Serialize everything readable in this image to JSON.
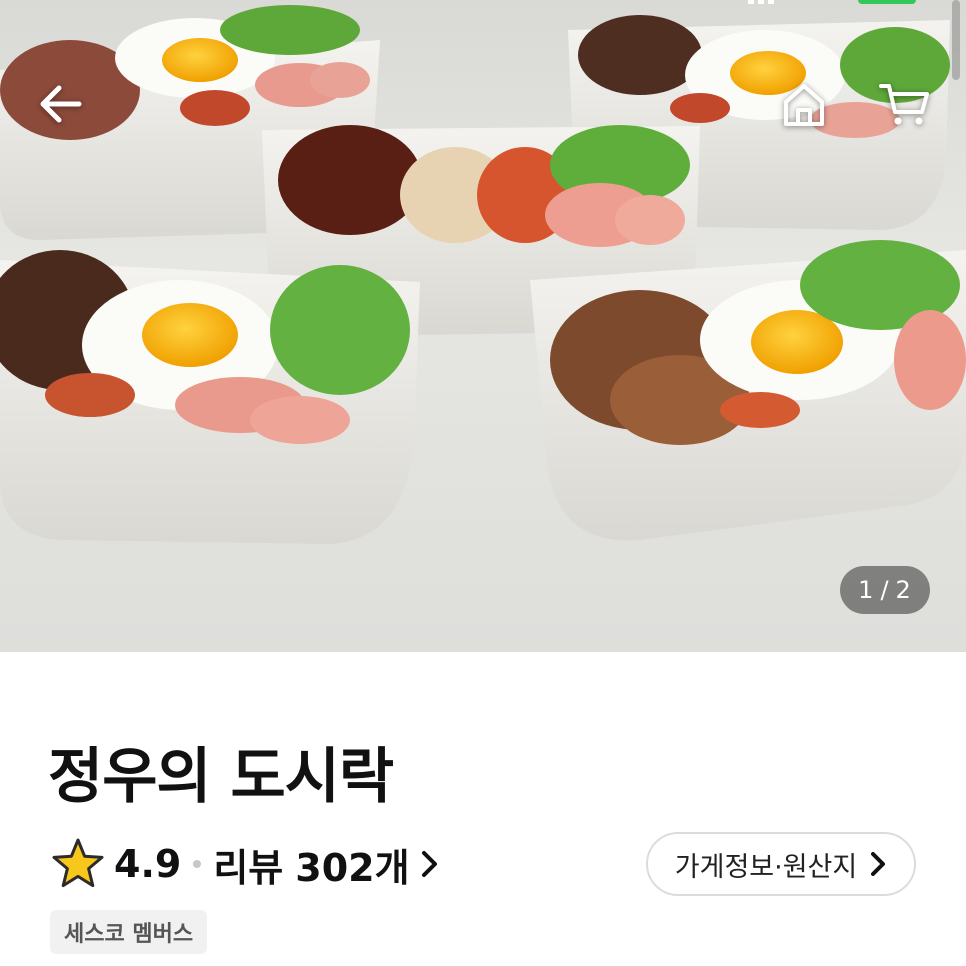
{
  "status_bar": {
    "time": "",
    "battery_color": "#34c759"
  },
  "header": {
    "back_icon": "arrow-left-icon",
    "home_icon": "home-icon",
    "cart_icon": "cart-icon"
  },
  "gallery": {
    "current": "1",
    "total": "2",
    "separator": "/"
  },
  "store": {
    "name": "정우의 도시락",
    "rating": "4.9",
    "review_label": "리뷰",
    "review_count": "302개",
    "info_button": "가게정보·원산지",
    "badge": "세스코 멤버스"
  },
  "colors": {
    "star_fill": "#f7c71b",
    "star_stroke": "#2b2b2b",
    "text": "#111111",
    "badge_bg": "#f1f1f1"
  }
}
